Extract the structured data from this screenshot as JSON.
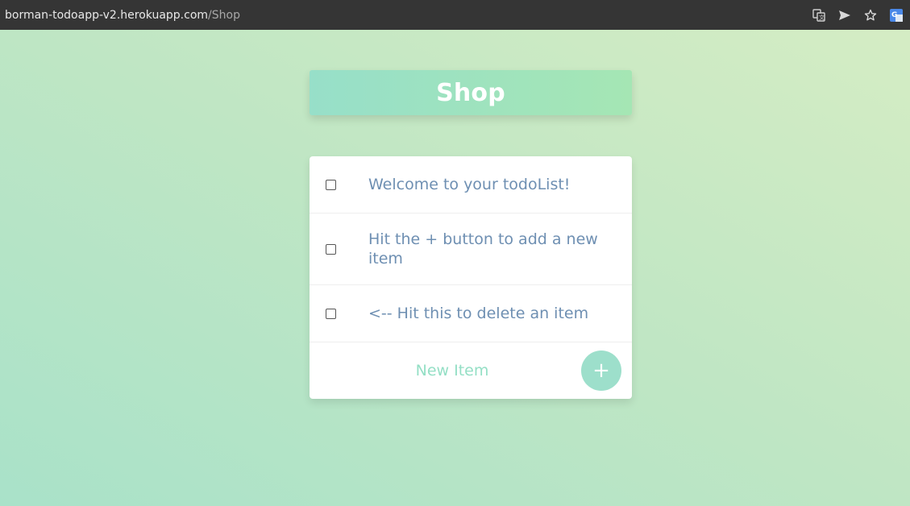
{
  "browser": {
    "url_host": "borman-todoapp-v2.herokuapp.com",
    "url_path": "/Shop",
    "icons": [
      "translate-icon",
      "send-icon",
      "star-icon",
      "google-translate-extension-icon"
    ]
  },
  "list": {
    "title": "Shop",
    "items": [
      {
        "text": "Welcome to your todoList!",
        "checked": false
      },
      {
        "text": "Hit the + button to add a new item",
        "checked": false
      },
      {
        "text": "<-- Hit this to delete an item",
        "checked": false
      }
    ],
    "new_item": {
      "placeholder": "New Item",
      "value": "",
      "add_button_label": "+"
    }
  },
  "colors": {
    "accent": "#9ddfcb",
    "item_text": "#6e8fb2",
    "browser_bar": "#353535"
  }
}
